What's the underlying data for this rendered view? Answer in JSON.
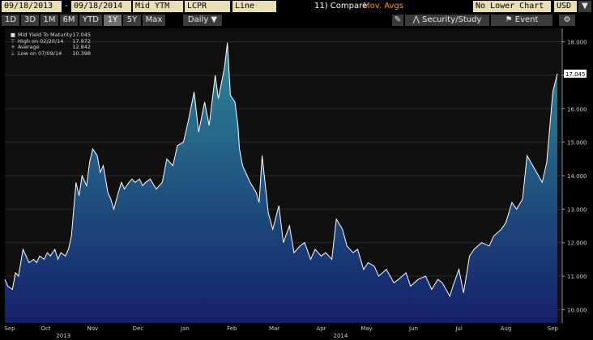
{
  "header": {
    "start_date": "09/18/2013",
    "end_date": "09/18/2014",
    "field": "Mid YTM",
    "source": "LCPR",
    "chart_style": "Line",
    "compare_label": "11) Compare",
    "mov_avgs": "Mov. Avgs",
    "lower_chart": "No Lower Chart",
    "currency": "USD"
  },
  "toolbar2": {
    "ranges": [
      "1D",
      "3D",
      "1M",
      "6M",
      "YTD",
      "1Y",
      "5Y",
      "Max"
    ],
    "active_range": "1Y",
    "frequency": "Daily",
    "security_study": "Security/Study",
    "event": "Event"
  },
  "legend": {
    "rows": [
      {
        "label": "Mid Yield To Maturity",
        "value": "17.045"
      },
      {
        "label": "High on 02/20/14",
        "value": "17.972"
      },
      {
        "label": "Average",
        "value": "12.842"
      },
      {
        "label": "Low on 07/09/14",
        "value": "10.398"
      }
    ]
  },
  "colors": {
    "background": "#000000",
    "line": "#ffffff",
    "fill_top": "#2e8a98",
    "fill_bottom": "#14206a",
    "last_price_box": "#ffffff",
    "toolbar_field": "#e8ddb3",
    "accent_orange": "#ff9a00"
  },
  "chart_data": {
    "type": "area",
    "title": "",
    "ylabel": "",
    "xlabel": "",
    "ylim": [
      9.6,
      18.4
    ],
    "yticks": [
      10.0,
      11.0,
      12.0,
      13.0,
      14.0,
      15.0,
      16.0,
      17.0,
      18.0
    ],
    "month_labels": [
      "Sep",
      "Oct",
      "Nov",
      "Dec",
      "Jan",
      "Feb",
      "Mar",
      "Apr",
      "May",
      "Jun",
      "Jul",
      "Aug",
      "Sep"
    ],
    "year_labels": [
      "2013",
      "2014"
    ],
    "last_value_label": "17.045",
    "series": [
      {
        "name": "Mid Yield To Maturity",
        "x": [
          "2013-09-18",
          "2013-09-20",
          "2013-09-23",
          "2013-09-25",
          "2013-09-27",
          "2013-09-30",
          "2013-10-02",
          "2013-10-04",
          "2013-10-07",
          "2013-10-09",
          "2013-10-11",
          "2013-10-14",
          "2013-10-16",
          "2013-10-18",
          "2013-10-21",
          "2013-10-23",
          "2013-10-25",
          "2013-10-28",
          "2013-10-30",
          "2013-11-01",
          "2013-11-04",
          "2013-11-06",
          "2013-11-08",
          "2013-11-11",
          "2013-11-13",
          "2013-11-15",
          "2013-11-18",
          "2013-11-20",
          "2013-11-22",
          "2013-11-25",
          "2013-11-27",
          "2013-11-29",
          "2013-12-02",
          "2013-12-04",
          "2013-12-06",
          "2013-12-09",
          "2013-12-11",
          "2013-12-13",
          "2013-12-16",
          "2013-12-18",
          "2013-12-20",
          "2013-12-23",
          "2013-12-27",
          "2013-12-31",
          "2014-01-03",
          "2014-01-07",
          "2014-01-10",
          "2014-01-14",
          "2014-01-17",
          "2014-01-21",
          "2014-01-24",
          "2014-01-28",
          "2014-01-31",
          "2014-02-04",
          "2014-02-06",
          "2014-02-10",
          "2014-02-12",
          "2014-02-14",
          "2014-02-17",
          "2014-02-19",
          "2014-02-20",
          "2014-02-22",
          "2014-02-25",
          "2014-02-27",
          "2014-03-03",
          "2014-03-05",
          "2014-03-07",
          "2014-03-11",
          "2014-03-14",
          "2014-03-18",
          "2014-03-21",
          "2014-03-25",
          "2014-03-28",
          "2014-04-01",
          "2014-04-04",
          "2014-04-08",
          "2014-04-11",
          "2014-04-15",
          "2014-04-18",
          "2014-04-22",
          "2014-04-25",
          "2014-04-29",
          "2014-05-02",
          "2014-05-06",
          "2014-05-09",
          "2014-05-13",
          "2014-05-16",
          "2014-05-20",
          "2014-05-23",
          "2014-05-28",
          "2014-06-02",
          "2014-06-05",
          "2014-06-10",
          "2014-06-13",
          "2014-06-18",
          "2014-06-23",
          "2014-06-27",
          "2014-07-01",
          "2014-07-04",
          "2014-07-09",
          "2014-07-11",
          "2014-07-15",
          "2014-07-18",
          "2014-07-22",
          "2014-07-25",
          "2014-07-30",
          "2014-08-04",
          "2014-08-07",
          "2014-08-12",
          "2014-08-15",
          "2014-08-19",
          "2014-08-22",
          "2014-08-26",
          "2014-08-29",
          "2014-09-03",
          "2014-09-08",
          "2014-09-11",
          "2014-09-15",
          "2014-09-18"
        ],
        "values": [
          10.9,
          10.7,
          10.6,
          11.1,
          11.0,
          11.8,
          11.6,
          11.4,
          11.5,
          11.4,
          11.6,
          11.5,
          11.7,
          11.6,
          11.8,
          11.5,
          11.7,
          11.6,
          11.8,
          12.2,
          13.8,
          13.4,
          14.0,
          13.7,
          14.4,
          14.8,
          14.6,
          14.1,
          14.3,
          13.5,
          13.3,
          13.0,
          13.5,
          13.8,
          13.6,
          13.8,
          13.9,
          13.8,
          13.9,
          13.7,
          13.8,
          13.9,
          13.6,
          13.8,
          14.5,
          14.3,
          14.9,
          15.0,
          15.6,
          16.5,
          15.3,
          16.2,
          15.5,
          17.0,
          16.3,
          17.2,
          17.972,
          16.4,
          16.2,
          15.5,
          14.8,
          14.3,
          14.0,
          13.8,
          13.5,
          13.2,
          14.6,
          12.9,
          12.4,
          13.1,
          12.0,
          12.5,
          11.7,
          11.9,
          12.0,
          11.5,
          11.8,
          11.6,
          11.7,
          11.5,
          12.7,
          12.4,
          11.9,
          11.7,
          11.8,
          11.2,
          11.4,
          11.3,
          11.0,
          11.2,
          10.8,
          10.9,
          11.1,
          10.7,
          10.9,
          11.0,
          10.6,
          10.9,
          10.8,
          10.398,
          10.7,
          11.2,
          10.5,
          11.6,
          11.8,
          12.0,
          11.9,
          12.2,
          12.4,
          12.6,
          13.2,
          13.0,
          13.3,
          14.6,
          14.2,
          13.8,
          14.4,
          16.5,
          17.045
        ]
      }
    ],
    "grid": true,
    "legend_position": "top-left"
  }
}
